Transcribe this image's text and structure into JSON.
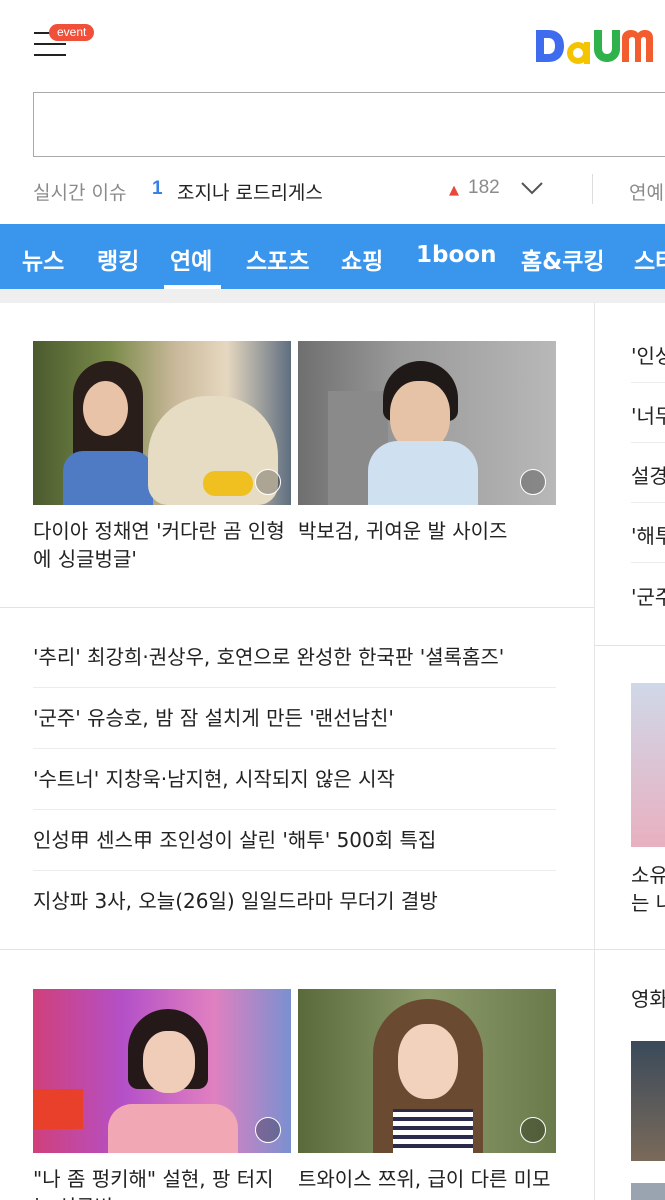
{
  "header": {
    "event_badge": "event",
    "logo_text": "Daum",
    "logo_colors": [
      "#3f6bef",
      "#f5c400",
      "#2fb24c",
      "#f25c2f"
    ]
  },
  "search": {
    "placeholder": "",
    "value": ""
  },
  "realtime_issue": {
    "label": "실시간 이슈",
    "rank": "1",
    "keyword": "조지나 로드리게스",
    "trend_count": "182",
    "next_label": "연예"
  },
  "nav": {
    "active_index": 2,
    "items": [
      "뉴스",
      "랭킹",
      "연예",
      "스포츠",
      "쇼핑",
      "1boon",
      "홈&쿠킹",
      "스타"
    ]
  },
  "main": {
    "top_cards": [
      {
        "caption": "다이아 정채연 '커다란 곰 인형에 싱글벙글'"
      },
      {
        "caption": "박보검, 귀여운 발 사이즈"
      }
    ],
    "headlines": [
      "'추리' 최강희·권상우, 호연으로 완성한 한국판 '셜록홈즈'",
      "'군주' 유승호, 밤 잠 설치게 만든 '랜선남친'",
      "'수트너' 지창욱·남지현, 시작되지 않은 시작",
      "인성甲 센스甲 조인성이 살린 '해투' 500회 특집",
      "지상파 3사, 오늘(26일) 일일드라마 무더기 결방"
    ],
    "bottom_cards": [
      {
        "caption": "\"나 좀 펑키해\" 설현, 팡 터지는 싱글벙"
      },
      {
        "caption": "트와이스 쯔위, 급이 다른 미모"
      }
    ]
  },
  "side": {
    "items": [
      "'인성",
      "'너무",
      "설경",
      "'해투",
      "'군주"
    ],
    "caption_lines": [
      "소유",
      "는 나"
    ],
    "section_title": "영화"
  }
}
